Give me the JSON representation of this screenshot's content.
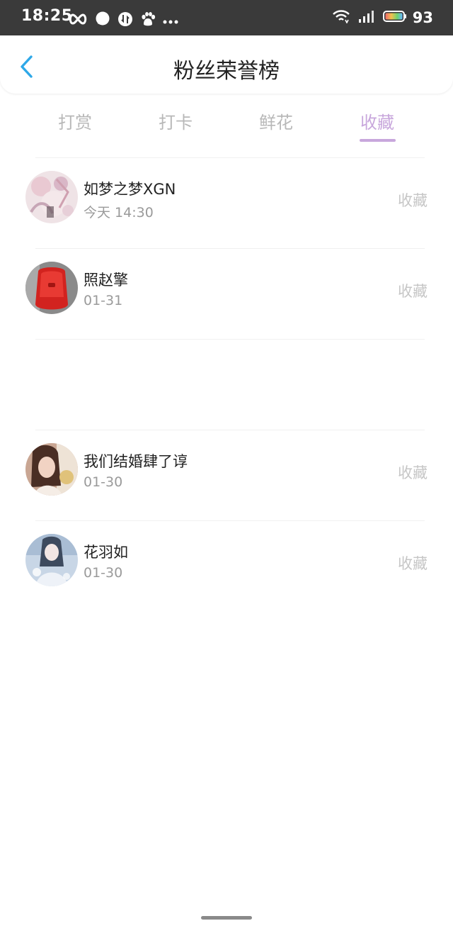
{
  "status_bar": {
    "time": "18:25",
    "battery_level": "93",
    "left_icons": [
      "infinity-icon",
      "chat-bubble-icon",
      "swap-icon",
      "baidu-paw-icon",
      "more-dots-icon"
    ],
    "right_icons": [
      "wifi-icon",
      "signal-icon",
      "battery-icon"
    ]
  },
  "header": {
    "title": "粉丝荣誉榜",
    "back_icon": "chevron-left-icon",
    "accent_color": "#2ea8e8"
  },
  "tabs": [
    {
      "label": "打赏",
      "active": false
    },
    {
      "label": "打卡",
      "active": false
    },
    {
      "label": "鲜花",
      "active": false
    },
    {
      "label": "收藏",
      "active": true
    }
  ],
  "tab_active_color": "#c8a7dc",
  "list": [
    {
      "name": "如梦之梦XGN",
      "date": "今天 14:30",
      "action": "收藏"
    },
    {
      "name": "照赵擎",
      "date": "01-31",
      "action": "收藏"
    },
    {
      "name": "我们结婚肆了谆",
      "date": "01-30",
      "action": "收藏"
    },
    {
      "name": "花羽如",
      "date": "01-30",
      "action": "收藏"
    }
  ]
}
